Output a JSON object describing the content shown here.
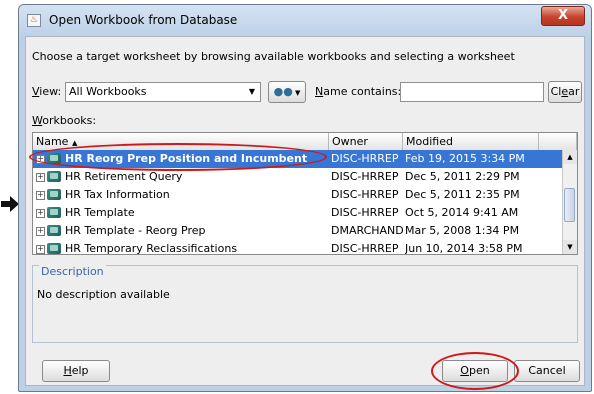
{
  "window": {
    "title": "Open Workbook from Database",
    "close_glyph": "X"
  },
  "instruction": "Choose a target worksheet by browsing available workbooks and selecting a worksheet",
  "filter": {
    "view_label_key": "V",
    "view_label_rest": "iew:",
    "view_value": "All Workbooks",
    "name_label_key": "N",
    "name_label_rest": "ame contains:",
    "name_value": "",
    "clear_key": "e",
    "clear_pre": "Cl",
    "clear_post": "ar"
  },
  "workbooks_label_key": "W",
  "workbooks_label_rest": "orkbooks:",
  "table": {
    "columns": [
      {
        "label": "Name",
        "sort_indicator": "▲"
      },
      {
        "label": "Owner"
      },
      {
        "label": "Modified"
      }
    ],
    "rows": [
      {
        "name": "HR Reorg Prep Position and Incumbent",
        "owner": "DISC-HRREP",
        "modified": "Feb 19, 2015 3:34 PM",
        "selected": true
      },
      {
        "name": "HR Retirement Query",
        "owner": "DISC-HRREP",
        "modified": "Dec 5, 2011 2:29 PM",
        "selected": false
      },
      {
        "name": "HR Tax Information",
        "owner": "DISC-HRREP",
        "modified": "Dec 5, 2011 2:35 PM",
        "selected": false
      },
      {
        "name": "HR Template",
        "owner": "DISC-HRREP",
        "modified": "Oct 5, 2014 9:41 AM",
        "selected": false
      },
      {
        "name": "HR Template - Reorg Prep",
        "owner": "DMARCHAND",
        "modified": "Mar 5, 2008 1:34 PM",
        "selected": false
      },
      {
        "name": "HR Temporary Reclassifications",
        "owner": "DISC-HRREP",
        "modified": "Jun 10, 2014 3:58 PM",
        "selected": false
      }
    ]
  },
  "description": {
    "title": "Description",
    "text": "No description available"
  },
  "buttons": {
    "help_key": "H",
    "help_rest": "elp",
    "open_key": "O",
    "open_rest": "pen",
    "cancel": "Cancel"
  },
  "colors": {
    "selection": "#3876d6",
    "annotation": "#cc1a1a"
  }
}
